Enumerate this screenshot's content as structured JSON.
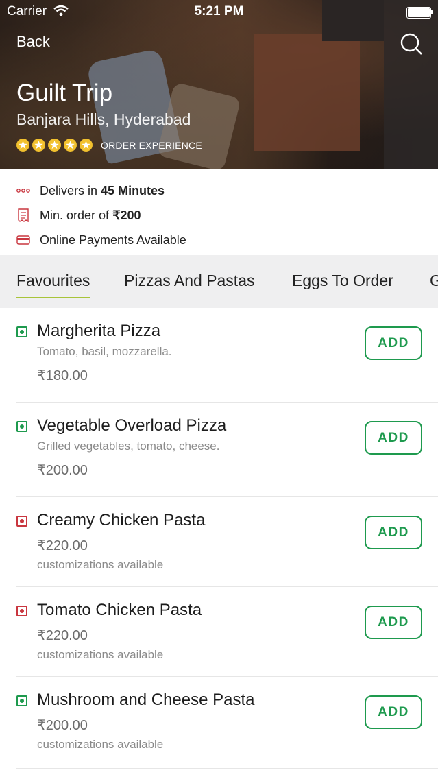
{
  "status_bar": {
    "carrier": "Carrier",
    "time": "5:21 PM"
  },
  "header": {
    "back_label": "Back",
    "restaurant_name": "Guilt Trip",
    "location": "Banjara Hills, Hyderabad",
    "rating_stars": 5,
    "rating_label": "ORDER EXPERIENCE"
  },
  "info": {
    "delivery_prefix": "Delivers in ",
    "delivery_time": "45 Minutes",
    "min_order_prefix": "Min. order of ",
    "min_order_value": "₹200",
    "payments": "Online Payments Available"
  },
  "tabs": [
    {
      "label": "Favourites",
      "active": true
    },
    {
      "label": "Pizzas And Pastas",
      "active": false
    },
    {
      "label": "Eggs To Order",
      "active": false
    },
    {
      "label": "G",
      "active": false
    }
  ],
  "menu": [
    {
      "name": "Margherita Pizza",
      "description": "Tomato, basil, mozzarella.",
      "price": "₹180.00",
      "customization": "",
      "type": "veg",
      "add_label": "ADD"
    },
    {
      "name": "Vegetable Overload Pizza",
      "description": "Grilled vegetables, tomato, cheese.",
      "price": "₹200.00",
      "customization": "",
      "type": "veg",
      "add_label": "ADD"
    },
    {
      "name": "Creamy Chicken Pasta",
      "description": "",
      "price": "₹220.00",
      "customization": "customizations available",
      "type": "nonveg",
      "add_label": "ADD"
    },
    {
      "name": "Tomato Chicken Pasta",
      "description": "",
      "price": "₹220.00",
      "customization": "customizations available",
      "type": "nonveg",
      "add_label": "ADD"
    },
    {
      "name": "Mushroom and Cheese Pasta",
      "description": "",
      "price": "₹200.00",
      "customization": "customizations available",
      "type": "veg",
      "add_label": "ADD"
    }
  ],
  "colors": {
    "veg": "#1e9a4e",
    "nonveg": "#c9363f",
    "star": "#f2c12e",
    "tab_underline": "#a8c43a"
  }
}
